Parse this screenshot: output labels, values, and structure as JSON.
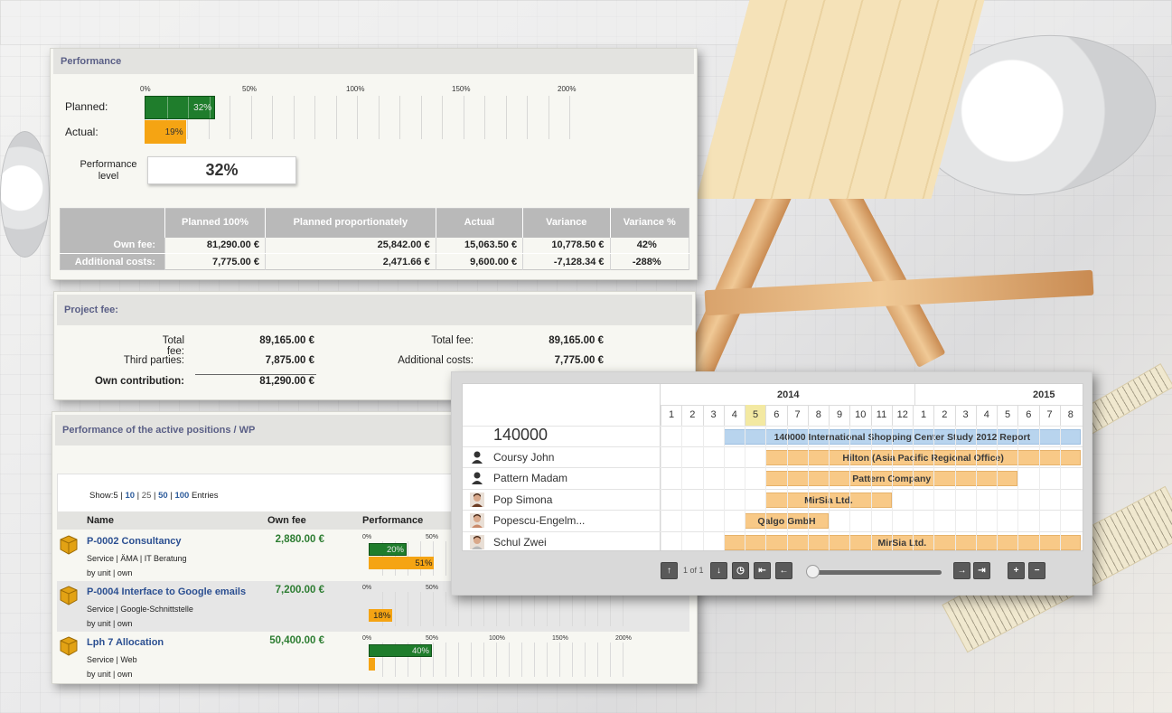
{
  "performance": {
    "title": "Performance",
    "scale": [
      "0%",
      "50%",
      "100%",
      "150%",
      "200%"
    ],
    "planned_label": "Planned:",
    "planned_pct": 32,
    "planned_text": "32%",
    "actual_label": "Actual:",
    "actual_pct": 19,
    "actual_text": "19%",
    "level_label_1": "Performance",
    "level_label_2": "level",
    "level_value": "32%",
    "colors": {
      "planned": "#1f7d2c",
      "actual": "#f5a413"
    },
    "table": {
      "headers": [
        "Planned 100%",
        "Planned proportionately",
        "Actual",
        "Variance",
        "Variance %"
      ],
      "rows": [
        {
          "label": "Own fee:",
          "cells": [
            "81,290.00 €",
            "25,842.00 €",
            "15,063.50 €",
            "10,778.50 €",
            "42%"
          ]
        },
        {
          "label": "Additional costs:",
          "cells": [
            "7,775.00 €",
            "2,471.66 €",
            "9,600.00 €",
            "-7,128.34 €",
            "-288%"
          ]
        }
      ]
    }
  },
  "project_fee": {
    "title": "Project fee:",
    "left": [
      {
        "label": "Total fee:",
        "value": "89,165.00 €"
      },
      {
        "label": "Third parties:",
        "value": "7,875.00 €"
      },
      {
        "label": "Own contribution:",
        "value": "81,290.00 €"
      }
    ],
    "right": [
      {
        "label": "Total fee:",
        "value": "89,165.00 €"
      },
      {
        "label": "Additional costs:",
        "value": "7,775.00 €"
      }
    ]
  },
  "positions": {
    "title": "Performance of the active positions / WP",
    "show_prefix": "Show:",
    "show_options": [
      "5",
      "10",
      "25",
      "50",
      "100"
    ],
    "show_suffix": "Entries",
    "columns": [
      "Name",
      "Own fee",
      "Performance"
    ],
    "scale": [
      "0%",
      "50%",
      "100%",
      "150%",
      "200%"
    ],
    "rows": [
      {
        "title": "P-0002 Consultancy",
        "line1": "Service | ÄMA | IT Beratung",
        "line2": "by unit | own",
        "fee": "2,880.00 €",
        "planned_pct": 20,
        "planned_text": "20%",
        "actual_pct": 51,
        "actual_text": "51%"
      },
      {
        "title": "P-0004 Interface to Google emails",
        "line1": "Service | Google-Schnittstelle",
        "line2": "by unit | own",
        "fee": "7,200.00 €",
        "planned_pct": 0,
        "planned_text": "",
        "actual_pct": 18,
        "actual_text": "18%"
      },
      {
        "title": "Lph 7 Allocation",
        "line1": "Service | Web",
        "line2": "by unit | own",
        "fee": "50,400.00 €",
        "planned_pct": 40,
        "planned_text": "40%",
        "actual_pct": 4,
        "actual_text": ""
      }
    ]
  },
  "gantt": {
    "years": [
      "2014",
      "2015"
    ],
    "months": [
      "1",
      "2",
      "3",
      "4",
      "5",
      "6",
      "7",
      "8",
      "9",
      "10",
      "11",
      "12",
      "1",
      "2",
      "3",
      "4",
      "5",
      "6",
      "7",
      "8"
    ],
    "highlight_month_index": 4,
    "project": "140000",
    "project_bar": "140000 International Shopping Center Study 2012 Report",
    "people": [
      {
        "name": "Coursy John",
        "avatar": "person-silhouette-icon",
        "bar": "Hilton (Asia Pacific Regional Office)"
      },
      {
        "name": "Pattern Madam",
        "avatar": "person-silhouette-icon",
        "bar": "Pattern Company"
      },
      {
        "name": "Pop Simona",
        "avatar": "person-photo",
        "bar": "MirSia Ltd."
      },
      {
        "name": "Popescu-Engelm...",
        "avatar": "person-photo",
        "bar": "Qalgo GmbH"
      },
      {
        "name": "Schul Zwei",
        "avatar": "person-photo",
        "bar": "MirSia Ltd."
      }
    ],
    "pager": "1 of 1",
    "buttons": {
      "up": "↑",
      "down": "↓",
      "clock": "◷",
      "prev_page": "⇤",
      "prev": "←",
      "next": "→",
      "next_page": "⇥",
      "zoom_in": "+",
      "zoom_out": "−"
    }
  }
}
